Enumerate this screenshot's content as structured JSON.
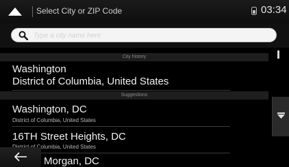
{
  "header": {
    "title": "Select City or ZIP Code",
    "time": "03:34"
  },
  "search": {
    "placeholder": "Type a city name here"
  },
  "sections": {
    "history": "City history",
    "suggestions": "Suggestions"
  },
  "history_item": {
    "name": "Washington",
    "region": "District of Columbia, United States"
  },
  "suggestions": [
    {
      "name": "Washington, DC",
      "region": "District of Columbia, United States"
    },
    {
      "name": "16TH Street Heights, DC",
      "region": "District of Columbia, United States"
    },
    {
      "name": "Morgan, DC"
    }
  ],
  "icons": {
    "nav": "navigation-arrow-icon",
    "gps": "gps-signal-icon",
    "search": "search-icon",
    "scroll_down": "scroll-down-icon",
    "back": "back-arrow-icon"
  }
}
